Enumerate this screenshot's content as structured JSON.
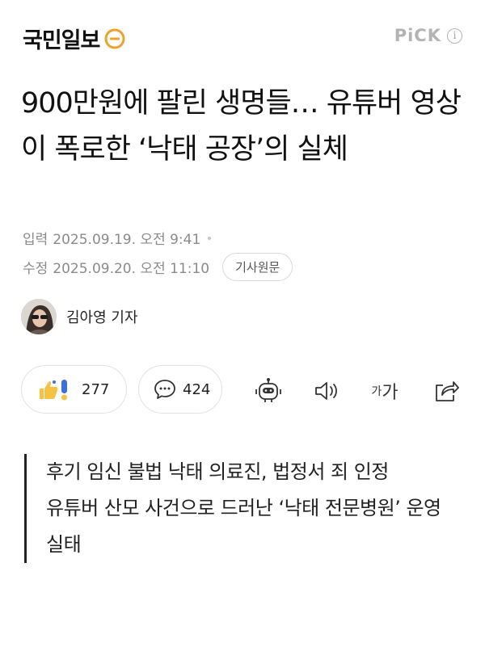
{
  "header": {
    "logo_text": "국민일보",
    "pick_label": "PiCK",
    "info_glyph": "i"
  },
  "article": {
    "title": "900만원에 팔린 생명들… 유튜버 영상이 폭로한 ‘낙태 공장’의 실체",
    "published_label": "입력",
    "published_at": "2025.09.19. 오전 9:41",
    "modified_label": "수정",
    "modified_at": "2025.09.20. 오전 11:10",
    "original_button": "기사원문"
  },
  "reporter": {
    "name": "김아영 기자"
  },
  "actions": {
    "reaction_count": "277",
    "comment_count": "424",
    "font_small": "가",
    "font_large": "가"
  },
  "summary": [
    "후기 임신 불법 낙태 의료진, 법정서 죄 인정",
    "유튜버 산모 사건으로 드러난 ‘낙태 전문병원’ 운영 실태"
  ],
  "colors": {
    "logo_orange": "#f0a12b",
    "muted_text": "#8a8a8a",
    "pick_gray": "#b3b3b3",
    "like_yellow": "#f6c244",
    "like_blue": "#3b6fd9"
  }
}
